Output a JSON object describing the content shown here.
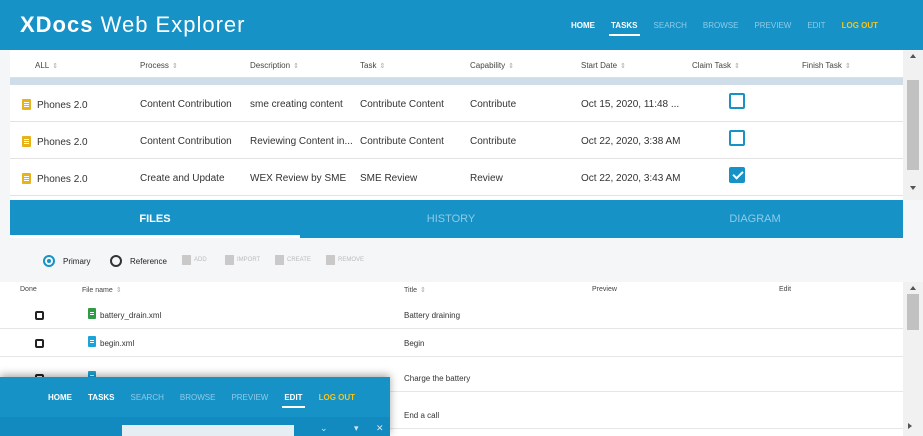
{
  "app": {
    "brand_bold": "XDocs",
    "brand_rest": "Web Explorer"
  },
  "nav": {
    "home": "HOME",
    "tasks": "TASKS",
    "search": "SEARCH",
    "browse": "BROWSE",
    "preview": "PREVIEW",
    "edit": "EDIT",
    "logout": "LOG OUT"
  },
  "colors": {
    "header": "#1692c7",
    "logout": "#f5c518",
    "checkbox": "#1692c7"
  },
  "tasks_table": {
    "columns": [
      "ALL",
      "Process",
      "Description",
      "Task",
      "Capability",
      "Start Date",
      "Claim Task",
      "Finish Task"
    ],
    "rows": [
      {
        "name": "Phones 2.0",
        "process": "Content Contribution",
        "description": "sme creating content",
        "task": "Contribute Content",
        "capability": "Contribute",
        "start": "Oct 15, 2020, 11:48 ...",
        "claimed": false
      },
      {
        "name": "Phones 2.0",
        "process": "Content Contribution",
        "description": "Reviewing Content in...",
        "task": "Contribute Content",
        "capability": "Contribute",
        "start": "Oct 22, 2020, 3:38 AM",
        "claimed": false
      },
      {
        "name": "Phones 2.0",
        "process": "Create and Update",
        "description": "WEX Review by SME",
        "task": "SME Review",
        "capability": "Review",
        "start": "Oct 22, 2020, 3:43 AM",
        "claimed": true
      }
    ]
  },
  "bottom_tabs": [
    "FILES",
    "HISTORY",
    "DIAGRAM"
  ],
  "files_toolbar": {
    "primary": "Primary",
    "reference": "Reference",
    "add": "ADD",
    "import": "IMPORT",
    "create": "CREATE",
    "remove": "REMOVE"
  },
  "files_table": {
    "columns": [
      "Done",
      "File name",
      "Title",
      "Preview",
      "Edit"
    ],
    "rows": [
      {
        "file": "battery_drain.xml",
        "title": "Battery draining",
        "icon": "green"
      },
      {
        "file": "begin.xml",
        "title": "Begin",
        "icon": "teal"
      },
      {
        "file": "",
        "title": "Charge the battery",
        "icon": "teal"
      },
      {
        "file": "",
        "title": "End a call",
        "icon": "teal"
      }
    ]
  },
  "overlay_nav": {
    "home": "HOME",
    "tasks": "TASKS",
    "search": "SEARCH",
    "browse": "BROWSE",
    "preview": "PREVIEW",
    "edit": "EDIT",
    "logout": "LOG OUT"
  }
}
